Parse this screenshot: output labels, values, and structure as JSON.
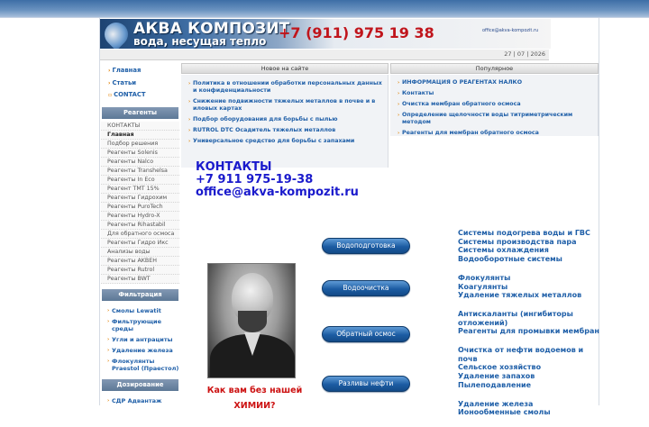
{
  "banner": {
    "title": "АКВА КОМПОЗИТ",
    "subtitle": "вода, несущая тепло",
    "phone": "+7 (911) 975 19 38",
    "email": "office@akva-kompozit.ru",
    "date": "27 | 07 | 2026"
  },
  "nav": {
    "items": [
      {
        "label": "Главная"
      },
      {
        "label": "Статьи"
      },
      {
        "label": "CONTACT"
      }
    ]
  },
  "reagents": {
    "heading": "Реагенты",
    "items": [
      "КОНТАКТЫ",
      "Главная",
      "Подбор решения",
      "Реагенты Solenis",
      "Реагенты Nalco",
      "Реагенты Transhelsa",
      "Реагенты In Eco",
      "Реагент ТМТ 15%",
      "Реагенты Гидрохим",
      "Реагенты PuroTech",
      "Реагенты Hydro-X",
      "Реагенты Rihastabil",
      "Для обратного осмоса",
      "Реагенты Гидро Икс",
      "Анализы воды",
      "Реагенты AKBEH",
      "Реагенты Rutrol",
      "Реагенты BWT"
    ]
  },
  "filtration": {
    "heading": "Фильтрация",
    "items": [
      "Смолы Lewatit",
      "Фильтрующие среды",
      "Угли и антрациты",
      "Удаление железа",
      "Флокулянты Praestol (Праестол)"
    ]
  },
  "dosing": {
    "heading": "Дозирование",
    "items": [
      "СДР Адвантаж"
    ]
  },
  "news": {
    "heading": "Новое на сайте",
    "items": [
      "Политика в отношении обработки персональных данных и конфиденциальности",
      "Снижение подвижности тяжелых металлов в почве и в иловых картах",
      "Подбор оборудования для борьбы с пылью",
      "RUTROL DTC Осадитель тяжелых металлов",
      "Универсальное средство для борьбы с запахами"
    ]
  },
  "popular": {
    "heading": "Популярное",
    "items": [
      "ИНФОРМАЦИЯ О РЕАГЕНТАХ НАЛКО",
      "Контакты",
      "Очистка мембран обратного осмоса",
      "Определение щелочности воды титриметрическим методом",
      "Реагенты для мембран обратного осмоса"
    ]
  },
  "contacts": {
    "title": "КОНТАКТЫ",
    "phone": "+7 911 975-19-38",
    "email": "office@akva-kompozit.ru"
  },
  "buttons": [
    {
      "label": "Водоподготовка"
    },
    {
      "label": "Водоочистка"
    },
    {
      "label": "Обратный осмос"
    },
    {
      "label": "Разливы нефти"
    }
  ],
  "caption": {
    "line1": "Как вам без нашей",
    "line2": "ХИМИИ?"
  },
  "categories": [
    {
      "links": [
        "Системы подогрева воды и ГВС",
        "Системы производства пара",
        "Системы охлаждения",
        "Водооборотные системы"
      ]
    },
    {
      "links": [
        "Флокулянты",
        "Коагулянты",
        "Удаление тяжелых металлов"
      ]
    },
    {
      "links": [
        "Антискаланты (ингибиторы отложений)",
        "Реагенты для промывки мембран"
      ]
    },
    {
      "links": [
        "Очистка от нефти водоемов и почв",
        "Сельское хозяйство",
        "Удаление запахов",
        "Пылеподавление"
      ]
    },
    {
      "links": [
        "Удаление железа",
        "Ионообменные смолы"
      ]
    }
  ]
}
